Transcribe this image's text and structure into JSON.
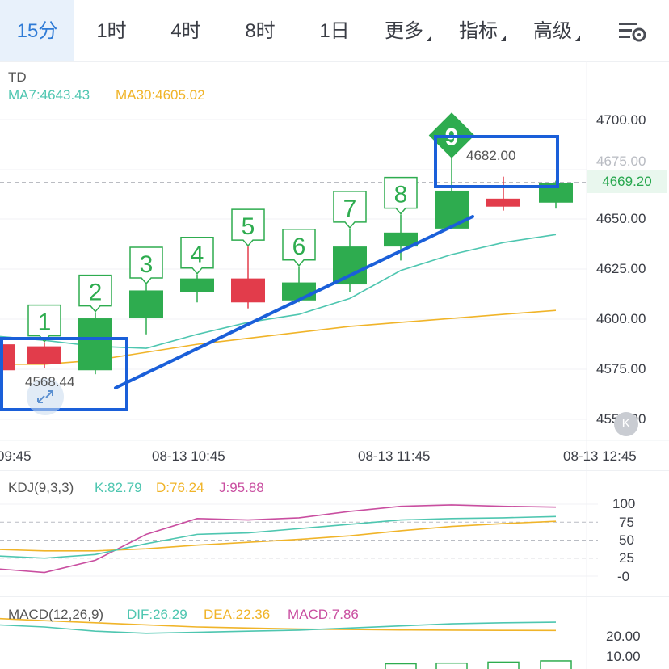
{
  "tabs": [
    {
      "label": "15分",
      "active": true
    },
    {
      "label": "1时"
    },
    {
      "label": "4时"
    },
    {
      "label": "8时"
    },
    {
      "label": "1日"
    },
    {
      "label": "更多"
    },
    {
      "label": "指标"
    },
    {
      "label": "高级"
    }
  ],
  "settings_icon": "settings-gear-icon",
  "main": {
    "indicator_title": "TD",
    "ma7_label": "MA7:4643.43",
    "ma30_label": "MA30:4605.02",
    "last_price": "4669.20",
    "high_marker": "4682.00",
    "low_marker": "4568.44",
    "y_ticks": [
      "4700.00",
      "4675.00",
      "4650.00",
      "4625.00",
      "4600.00",
      "4575.00",
      "4550.00"
    ],
    "x_ticks": [
      "09:45",
      "08-13 10:45",
      "08-13 11:45",
      "08-13 12:45"
    ],
    "td_counts": [
      "1",
      "2",
      "3",
      "4",
      "5",
      "6",
      "7",
      "8",
      "9"
    ],
    "k_button": "K",
    "colors": {
      "up": "#2eac4f",
      "down": "#e23c4b",
      "ma7": "#4ec6b0",
      "ma30": "#f0b429",
      "annotation": "#1a5fd9"
    }
  },
  "kdj": {
    "title": "KDJ(9,3,3)",
    "k_label": "K:82.79",
    "d_label": "D:76.24",
    "j_label": "J:95.88",
    "y_ticks": [
      "100",
      "75",
      "50",
      "25",
      "-0"
    ]
  },
  "macd": {
    "title": "MACD(12,26,9)",
    "dif_label": "DIF:26.29",
    "dea_label": "DEA:22.36",
    "macd_label": "MACD:7.86",
    "y_ticks": [
      "20.00",
      "10.00"
    ]
  },
  "chart_data": {
    "type": "candlestick",
    "title": "TD",
    "x_labels": [
      "09:45",
      "08-13 10:45",
      "08-13 11:45",
      "08-13 12:45"
    ],
    "ylim": [
      4545,
      4710
    ],
    "candles": [
      {
        "open": 4588,
        "close": 4575,
        "high": 4592,
        "low": 4572,
        "td": ""
      },
      {
        "open": 4587,
        "close": 4578,
        "high": 4589,
        "low": 4576,
        "td": "1"
      },
      {
        "open": 4575,
        "close": 4601,
        "high": 4604,
        "low": 4573,
        "td": "2"
      },
      {
        "open": 4601,
        "close": 4615,
        "high": 4618,
        "low": 4593,
        "td": "3"
      },
      {
        "open": 4614,
        "close": 4621,
        "high": 4623,
        "low": 4609,
        "td": "4"
      },
      {
        "open": 4621,
        "close": 4609,
        "high": 4637,
        "low": 4606,
        "td": "5"
      },
      {
        "open": 4610,
        "close": 4619,
        "high": 4627,
        "low": 4609,
        "td": "6"
      },
      {
        "open": 4618,
        "close": 4637,
        "high": 4646,
        "low": 4614,
        "td": "7"
      },
      {
        "open": 4637,
        "close": 4644,
        "high": 4653,
        "low": 4630,
        "td": "8"
      },
      {
        "open": 4646,
        "close": 4665,
        "high": 4683,
        "low": 4646,
        "td": "9"
      },
      {
        "open": 4661,
        "close": 4657,
        "high": 4672,
        "low": 4655,
        "td": ""
      },
      {
        "open": 4659,
        "close": 4669,
        "high": 4670,
        "low": 4656,
        "td": ""
      }
    ],
    "ma7": [
      4592,
      4590,
      4587,
      4586,
      4593,
      4599,
      4603,
      4611,
      4625,
      4633,
      4639,
      4643
    ],
    "ma30": [
      4578,
      4578,
      4580,
      4584,
      4588,
      4591,
      4594,
      4597,
      4599,
      4601,
      4603,
      4605
    ],
    "kdj": {
      "K": [
        28,
        25,
        30,
        45,
        58,
        60,
        66,
        72,
        78,
        80,
        81,
        82.79
      ],
      "D": [
        37,
        35,
        35,
        38,
        43,
        47,
        51,
        56,
        63,
        69,
        73,
        76.24
      ],
      "J": [
        10,
        5,
        22,
        58,
        80,
        78,
        81,
        90,
        97,
        99,
        97,
        95.88
      ],
      "ylim": [
        -5,
        110
      ]
    },
    "macd": {
      "DIF": [
        25,
        24,
        22,
        21,
        21.5,
        22,
        22.5,
        23.5,
        24.5,
        25.5,
        26,
        26.29
      ],
      "DEA": [
        28,
        27,
        26,
        25,
        24,
        23.5,
        23,
        22.8,
        22.6,
        22.5,
        22.4,
        22.36
      ],
      "hist": [
        null,
        null,
        null,
        null,
        null,
        null,
        null,
        null,
        6.5,
        6.8,
        7.3,
        7.86
      ],
      "ylim": [
        4,
        26
      ]
    }
  }
}
